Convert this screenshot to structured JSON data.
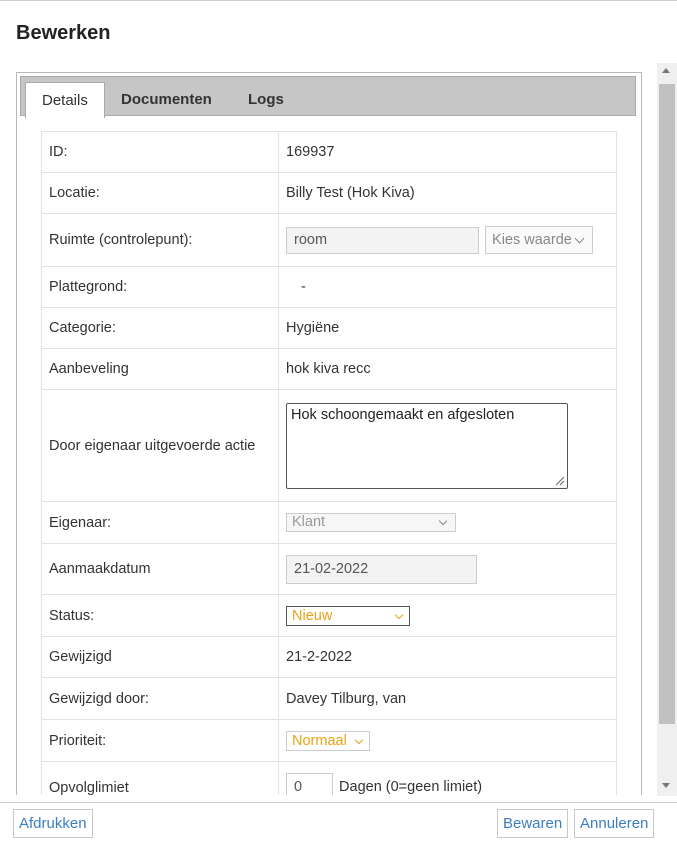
{
  "dialog": {
    "title": "Bewerken"
  },
  "tabs": [
    {
      "label": "Details",
      "active": true
    },
    {
      "label": "Documenten",
      "active": false
    },
    {
      "label": "Logs",
      "active": false
    }
  ],
  "fields": {
    "id": {
      "label": "ID:",
      "value": "169937"
    },
    "locatie": {
      "label": "Locatie:",
      "value": "Billy Test (Hok Kiva)"
    },
    "ruimte": {
      "label": "Ruimte (controlepunt):",
      "input_value": "room",
      "select_value": "Kies waarde"
    },
    "plattegrond": {
      "label": "Plattegrond:",
      "value": "-"
    },
    "categorie": {
      "label": "Categorie:",
      "value": "Hygiëne"
    },
    "aanbeveling": {
      "label": "Aanbeveling",
      "value": "hok kiva recc"
    },
    "actie": {
      "label": "Door eigenaar uitgevoerde actie",
      "value": "Hok schoongemaakt en afgesloten"
    },
    "eigenaar": {
      "label": "Eigenaar:",
      "value": "Klant"
    },
    "aanmaakdatum": {
      "label": "Aanmaakdatum",
      "value": "21-02-2022"
    },
    "status": {
      "label": "Status:",
      "value": "Nieuw"
    },
    "gewijzigd": {
      "label": "Gewijzigd",
      "value": "21-2-2022"
    },
    "gewijzigd_door": {
      "label": "Gewijzigd door:",
      "value": "Davey Tilburg, van"
    },
    "prioriteit": {
      "label": "Prioriteit:",
      "value": "Normaal"
    },
    "opvolglimiet": {
      "label": "Opvolglimiet",
      "value": "0",
      "suffix": "Dagen (0=geen limiet)"
    }
  },
  "buttons": {
    "print": "Afdrukken",
    "save": "Bewaren",
    "cancel": "Annuleren"
  },
  "colors": {
    "link": "#3b7ec2",
    "accent_orange": "#e8a317",
    "tabbar": "#c6c6c6"
  }
}
